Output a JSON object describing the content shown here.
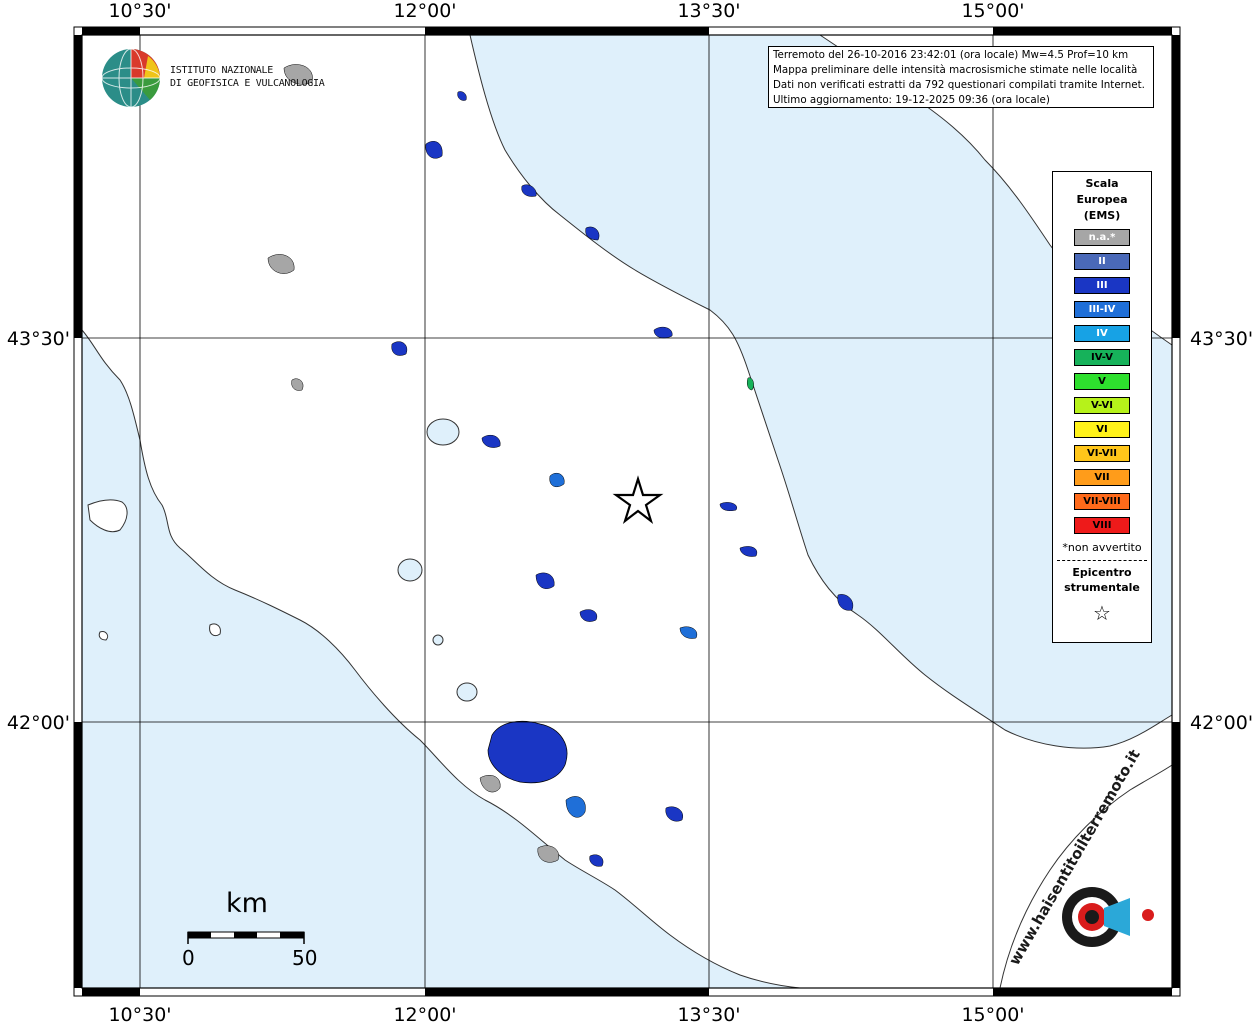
{
  "map": {
    "top_longitude_labels": [
      "10°30'",
      "12°00'",
      "13°30'",
      "15°00'"
    ],
    "bottom_longitude_labels": [
      "10°30'",
      "12°00'",
      "13°30'",
      "15°00'"
    ],
    "left_latitude_labels": [
      "43°30'",
      "42°00'"
    ],
    "right_latitude_labels": [
      "43°30'",
      "42°00'"
    ],
    "sea_color": "#dff0fb",
    "land_color": "#ffffff",
    "epicenter_marker": "star-icon"
  },
  "header": {
    "line1": "Terremoto del 26-10-2016 23:42:01 (ora locale) Mw=4.5 Prof=10 km",
    "line2": "Mappa preliminare delle intensità macrosismiche stimate nelle località",
    "line3": "Dati non verificati estratti da 792 questionari compilati tramite Internet.",
    "line4": "Ultimo aggiornamento: 19-12-2025 09:36 (ora locale)"
  },
  "logo_ingv": {
    "line1": "ISTITUTO NAZIONALE",
    "line2": "DI GEOFISICA E VULCANOLOGIA"
  },
  "logo_hsit": {
    "text": "www.haisentitoilterremoto.it"
  },
  "legend": {
    "title_line1": "Scala",
    "title_line2": "Europea",
    "title_line3": "(EMS)",
    "items": [
      {
        "label": "n.a.*",
        "color": "#a6a6a6",
        "text_color": "#ffffff"
      },
      {
        "label": "II",
        "color": "#4a69b8",
        "text_color": "#ffffff"
      },
      {
        "label": "III",
        "color": "#1a36c4",
        "text_color": "#ffffff"
      },
      {
        "label": "III-IV",
        "color": "#1f6fd8",
        "text_color": "#ffffff"
      },
      {
        "label": "IV",
        "color": "#17a2e5",
        "text_color": "#ffffff"
      },
      {
        "label": "IV-V",
        "color": "#16b25a",
        "text_color": "#000000"
      },
      {
        "label": "V",
        "color": "#2ee02e",
        "text_color": "#000000"
      },
      {
        "label": "V-VI",
        "color": "#b6f21a",
        "text_color": "#000000"
      },
      {
        "label": "VI",
        "color": "#fff21a",
        "text_color": "#000000"
      },
      {
        "label": "VI-VII",
        "color": "#ffc61a",
        "text_color": "#000000"
      },
      {
        "label": "VII",
        "color": "#ff9c1a",
        "text_color": "#000000"
      },
      {
        "label": "VII-VIII",
        "color": "#ff6a1a",
        "text_color": "#000000"
      },
      {
        "label": "VIII",
        "color": "#ee1a1a",
        "text_color": "#000000"
      }
    ],
    "note": "*non avvertito",
    "epicenter_line1": "Epicentro",
    "epicenter_line2": "strumentale"
  },
  "scale_bar": {
    "unit": "km",
    "start": "0",
    "end": "50"
  }
}
